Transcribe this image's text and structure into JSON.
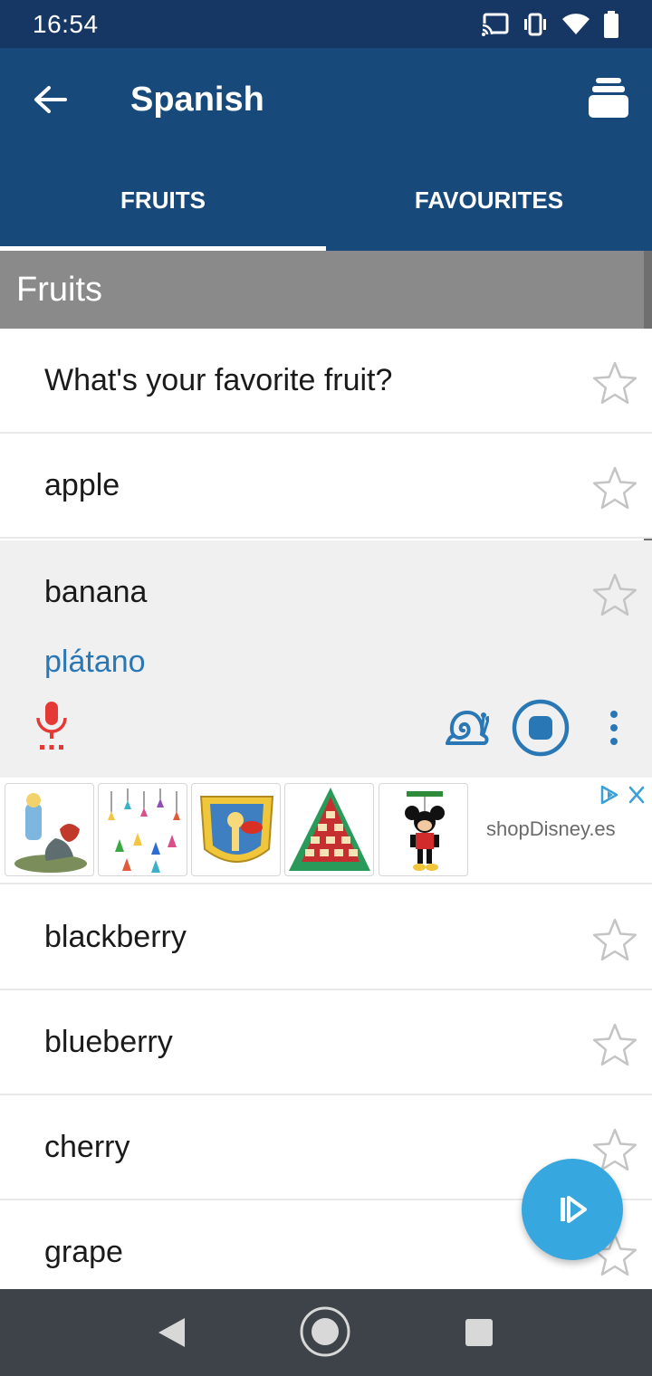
{
  "status_bar": {
    "time": "16:54",
    "icons": [
      "cast-icon",
      "vibrate-icon",
      "wifi-icon",
      "battery-icon"
    ]
  },
  "app_bar": {
    "title": "Spanish",
    "back_icon": "arrow-back-icon",
    "menu_icon": "stack-menu-icon"
  },
  "tabs": [
    {
      "label": "FRUITS",
      "active": true
    },
    {
      "label": "FAVOURITES",
      "active": false
    }
  ],
  "section": {
    "title": "Fruits"
  },
  "rows_top": [
    {
      "text": "What's your favorite fruit?"
    },
    {
      "text": "apple"
    }
  ],
  "expanded": {
    "text": "banana",
    "translation": "plátano",
    "icons": [
      "microphone-icon",
      "snail-slow-icon",
      "stop-playback-icon",
      "more-vertical-icon"
    ]
  },
  "ad": {
    "brand": "shopDisney.es",
    "tiles": [
      "alice-figurine",
      "princess-ornaments",
      "pluto-pin",
      "advent-calendar",
      "mickey-marionette"
    ],
    "choices_icon": "adchoices-close-icon"
  },
  "rows_bottom": [
    {
      "text": "blackberry"
    },
    {
      "text": "blueberry"
    },
    {
      "text": "cherry"
    },
    {
      "text": "grape"
    }
  ],
  "fab": {
    "icon": "play-all-icon"
  },
  "colors": {
    "primary": "#17497a",
    "status": "#163664",
    "accent": "#36a8df",
    "translation": "#2a77b5",
    "mic": "#e53935"
  }
}
